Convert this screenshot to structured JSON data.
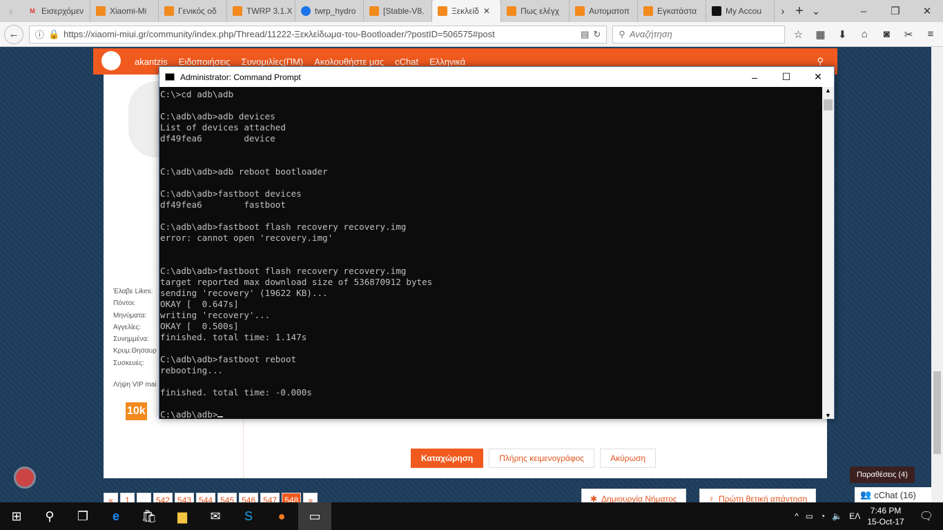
{
  "browser": {
    "tabs": [
      {
        "label": "Εισερχόμεν",
        "icon": "gmail-icon"
      },
      {
        "label": "Xiaomi-Mi",
        "icon": "miui-icon"
      },
      {
        "label": "Γενικός οδ",
        "icon": "miui-icon"
      },
      {
        "label": "TWRP 3.1.X",
        "icon": "miui-icon"
      },
      {
        "label": "twrp_hydro",
        "icon": "web-icon"
      },
      {
        "label": "[Stable-V8.",
        "icon": "miui-icon"
      },
      {
        "label": "Ξεκλείδ",
        "icon": "miui-icon",
        "active": true
      },
      {
        "label": "Πως ελέγχ",
        "icon": "miui-icon"
      },
      {
        "label": "Αυτοματοπ",
        "icon": "miui-icon"
      },
      {
        "label": "Εγκατάστα",
        "icon": "miui-icon"
      },
      {
        "label": "My Accou",
        "icon": "gg-icon"
      }
    ],
    "url": "https://xiaomi-miui.gr/community/index.php/Thread/11222-Ξεκλείδωμα-του-Bootloader/?postID=506575#post",
    "search_placeholder": "Αναζήτηση"
  },
  "site": {
    "nav": [
      "akantzis",
      "Ειδοποιήσεις",
      "Συνομιλίες(ΠΜ)",
      "Ακολουθήστε μας",
      "cChat",
      "Ελληνικά"
    ],
    "stats_labels": [
      "Έλαβε Likes:",
      "Πόντοι:",
      "Μηνύματα:",
      "Αγγελίες:",
      "Συνημμένα:",
      "Κρυμ.Θησαυρ",
      "Συσκευές:"
    ],
    "vip": "Λήψη VIP mai",
    "badge": "10k",
    "buttons": {
      "submit": "Καταχώρηση",
      "full_editor": "Πλήρης κειμενογράφος",
      "cancel": "Ακύρωση"
    },
    "pages": [
      "«",
      "1",
      "…",
      "542",
      "543",
      "544",
      "545",
      "546",
      "547",
      "548",
      "»"
    ],
    "current_page": "548",
    "new_thread": "Δημιουργία Νήματος",
    "first_positive": "Πρώτη θετική απάντηση",
    "quotes_tooltip": "Παραθέσεις (4)",
    "cchat": "cChat (16)"
  },
  "cmd": {
    "title": "Administrator: Command Prompt",
    "lines": [
      "C:\\>cd adb\\adb",
      "",
      "C:\\adb\\adb>adb devices",
      "List of devices attached",
      "df49fea6        device",
      "",
      "",
      "C:\\adb\\adb>adb reboot bootloader",
      "",
      "C:\\adb\\adb>fastboot devices",
      "df49fea6        fastboot",
      "",
      "C:\\adb\\adb>fastboot flash recovery recovery.img",
      "error: cannot open 'recovery.img'",
      "",
      "",
      "C:\\adb\\adb>fastboot flash recovery recovery.img",
      "target reported max download size of 536870912 bytes",
      "sending 'recovery' (19622 KB)...",
      "OKAY [  0.647s]",
      "writing 'recovery'...",
      "OKAY [  0.500s]",
      "finished. total time: 1.147s",
      "",
      "C:\\adb\\adb>fastboot reboot",
      "rebooting...",
      "",
      "finished. total time: -0.000s",
      "",
      "C:\\adb\\adb>"
    ]
  },
  "taskbar": {
    "time": "7:46 PM",
    "date": "15-Oct-17",
    "lang": "ΕΛ"
  }
}
